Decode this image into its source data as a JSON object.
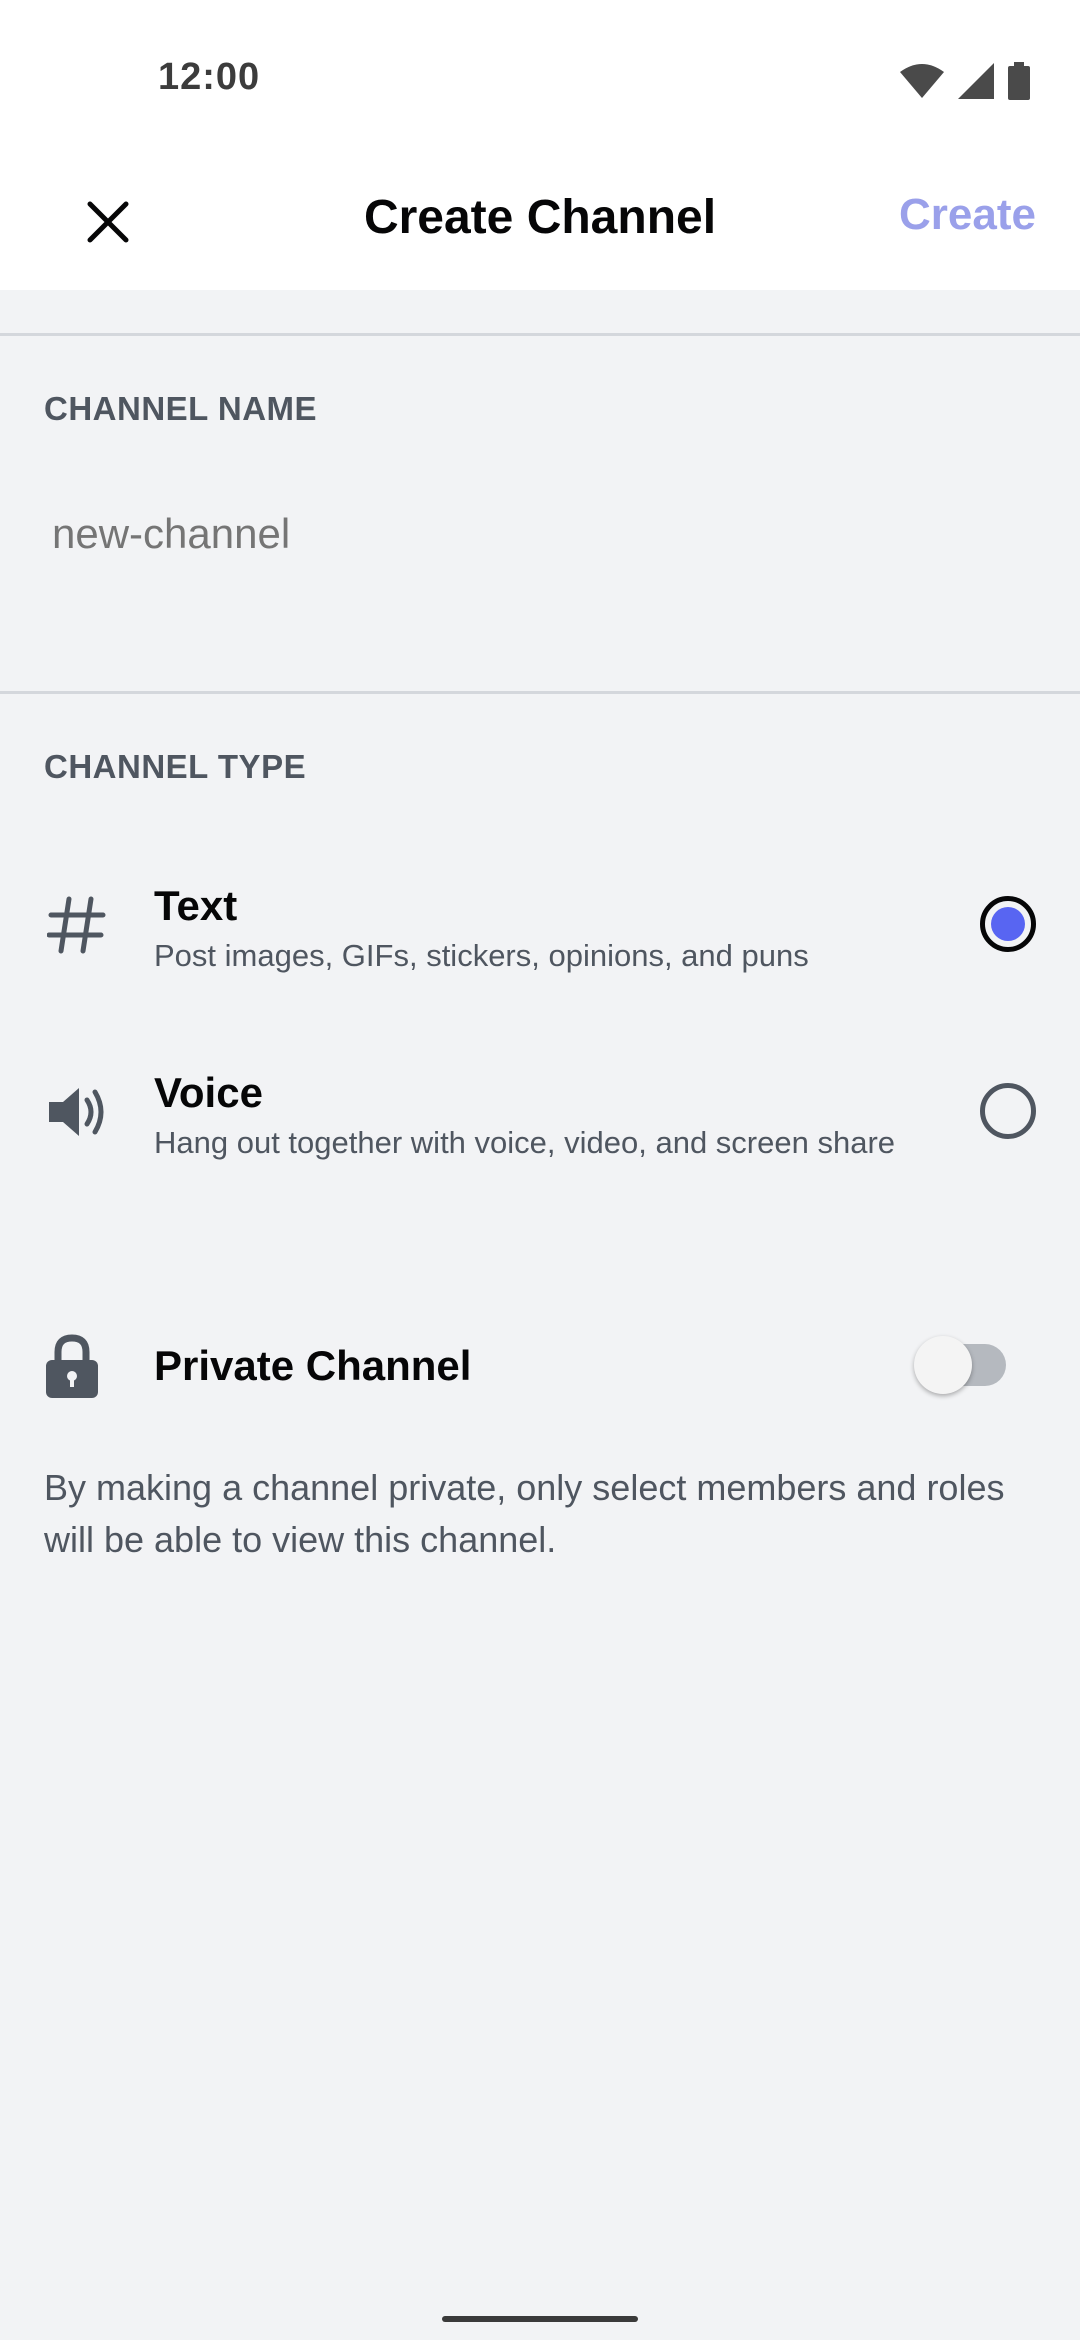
{
  "status_bar": {
    "time": "12:00",
    "icons": [
      "wifi-icon",
      "cellular-icon",
      "battery-icon"
    ]
  },
  "app_bar": {
    "close_icon": "close-icon",
    "title": "Create Channel",
    "create_label": "Create"
  },
  "channel_name": {
    "section_label": "CHANNEL NAME",
    "placeholder": "new-channel",
    "value": ""
  },
  "channel_type": {
    "section_label": "CHANNEL TYPE",
    "options": [
      {
        "icon": "hashtag-icon",
        "title": "Text",
        "description": "Post images, GIFs, stickers, opinions, and puns",
        "selected": true
      },
      {
        "icon": "speaker-icon",
        "title": "Voice",
        "description": "Hang out together with voice, video, and screen share",
        "selected": false
      }
    ]
  },
  "private_channel": {
    "icon": "lock-icon",
    "label": "Private Channel",
    "enabled": false,
    "description": "By making a channel private, only select members and roles will be able to view this channel."
  },
  "colors": {
    "accent": "#5865f2",
    "create_disabled": "#9aa0ea",
    "background": "#f2f3f5"
  }
}
